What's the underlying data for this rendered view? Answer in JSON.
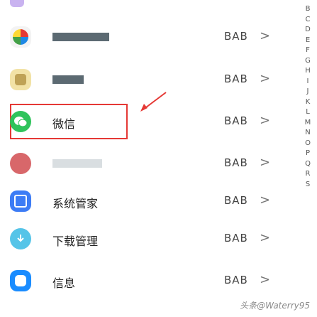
{
  "rows": [
    {
      "label": "",
      "right": "BAB",
      "icon": "pinwheel-icon"
    },
    {
      "label": "",
      "right": "BAB",
      "icon": "folder-icon"
    },
    {
      "label": "微信",
      "right": "BAB",
      "icon": "wechat-icon"
    },
    {
      "label": "",
      "right": "BAB",
      "icon": "app-icon"
    },
    {
      "label": "系统管家",
      "right": "BAB",
      "icon": "manager-icon"
    },
    {
      "label": "下载管理",
      "right": "BAB",
      "icon": "download-icon"
    },
    {
      "label": "信息",
      "right": "BAB",
      "icon": "messages-icon"
    }
  ],
  "chevron": ">",
  "alphabet_index": [
    "B",
    "C",
    "D",
    "E",
    "F",
    "G",
    "H",
    "I",
    "J",
    "K",
    "L",
    "M",
    "N",
    "O",
    "P",
    "Q",
    "R",
    "S"
  ],
  "watermark": "头条@Waterry95",
  "colors": {
    "highlight_border": "#e53935",
    "wechat": "#2fc35b",
    "manager": "#3d7cf5",
    "download": "#55c4e8",
    "messages": "#1a8cff",
    "app": "#d8676a"
  }
}
